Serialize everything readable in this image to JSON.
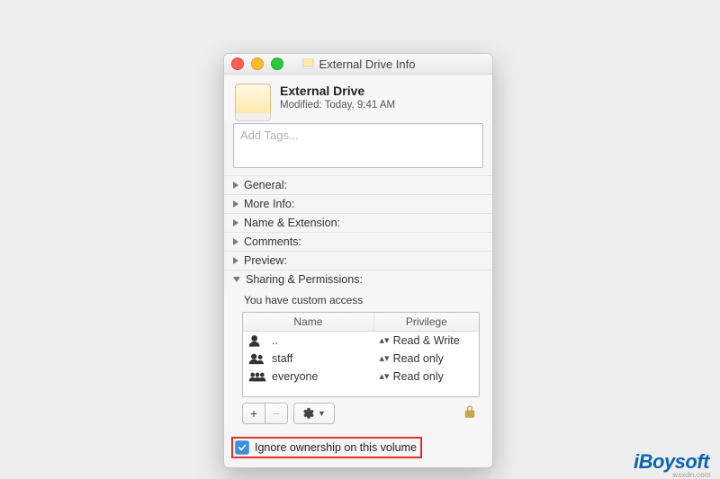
{
  "window": {
    "title": "External Drive Info"
  },
  "header": {
    "drive_name": "External Drive",
    "modified_label": "Modified: Today, 9:41 AM"
  },
  "tags_placeholder": "Add Tags...",
  "sections": {
    "general": "General:",
    "more_info": "More Info:",
    "name_ext": "Name & Extension:",
    "comments": "Comments:",
    "preview": "Preview:",
    "sharing": "Sharing & Permissions:"
  },
  "sharing": {
    "access_text": "You have custom access",
    "headers": {
      "name": "Name",
      "privilege": "Privilege"
    },
    "rows": [
      {
        "name": "..",
        "privilege": "Read & Write",
        "icon": "user"
      },
      {
        "name": "staff",
        "privilege": "Read only",
        "icon": "group"
      },
      {
        "name": "everyone",
        "privilege": "Read only",
        "icon": "everyone"
      }
    ],
    "ignore_label": "Ignore ownership on this volume",
    "ignore_checked": true
  },
  "watermark": {
    "brand": "iBoysoft",
    "domain": "wsxdn.com"
  }
}
